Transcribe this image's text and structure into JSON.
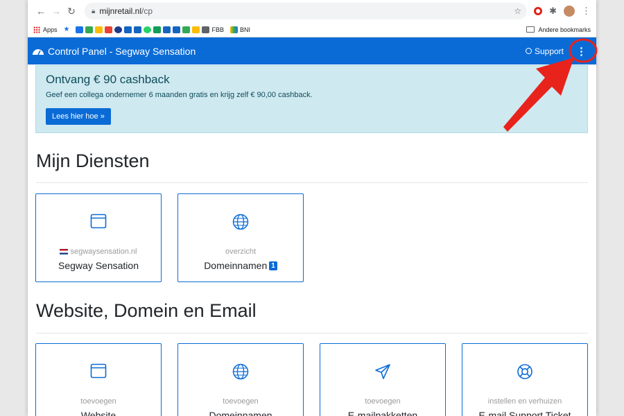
{
  "browser": {
    "url_domain": "mijnretail.nl",
    "url_path": "/cp",
    "bookmarks": [
      "Apps",
      "FBB",
      "BNI"
    ],
    "other_bookmarks": "Andere bookmarks"
  },
  "header": {
    "title": "Control Panel - Segway Sensation",
    "support": "Support"
  },
  "banner": {
    "title": "Ontvang € 90 cashback",
    "text": "Geef een collega ondernemer 6 maanden gratis en krijg zelf € 90,00 cashback.",
    "button": "Lees hier hoe »"
  },
  "sections": [
    {
      "title": "Mijn Diensten",
      "cards": [
        {
          "icon": "browser-window-icon",
          "sub": "segwaysensation.nl",
          "main": "Segway Sensation"
        },
        {
          "icon": "globe-icon",
          "sub": "overzicht",
          "main": "Domeinnamen",
          "badge": "1"
        }
      ]
    },
    {
      "title": "Website, Domein en Email",
      "cards": [
        {
          "icon": "browser-window-icon",
          "sub": "toevoegen",
          "main": "Website"
        },
        {
          "icon": "globe-icon",
          "sub": "toevoegen",
          "main": "Domeinnamen"
        },
        {
          "icon": "paper-plane-icon",
          "sub": "toevoegen",
          "main": "E-mailpakketten"
        },
        {
          "icon": "lifebuoy-icon",
          "sub": "instellen en verhuizen",
          "main": "E-mail Support Ticket"
        }
      ]
    }
  ],
  "colors": {
    "accent": "#0b6bd6",
    "annotation": "#e8231c"
  }
}
